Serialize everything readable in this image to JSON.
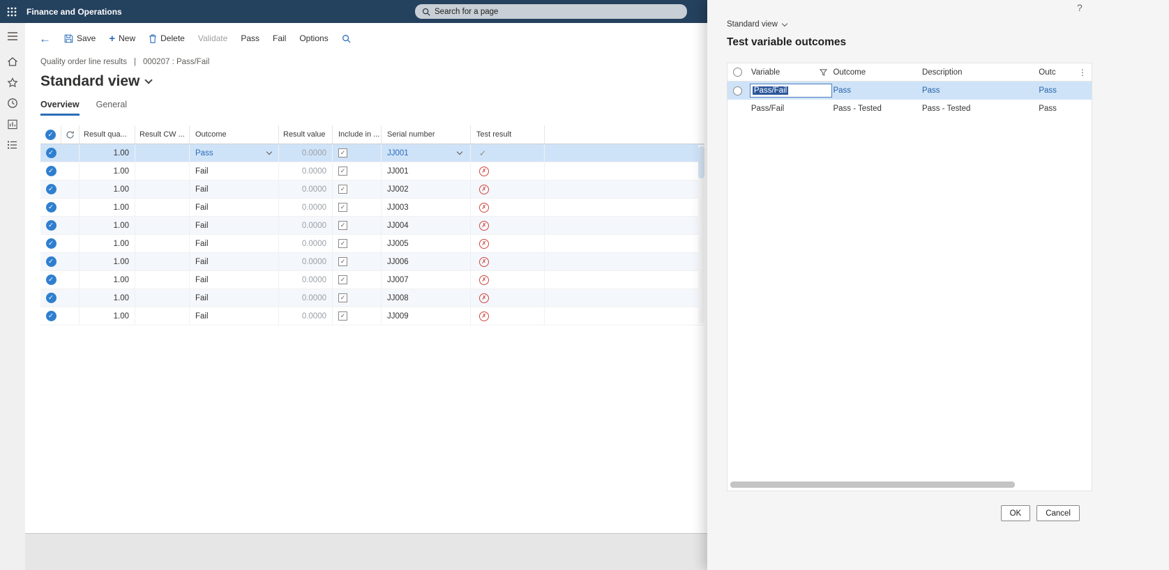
{
  "topbar": {
    "app_title": "Finance and Operations",
    "search_placeholder": "Search for a page"
  },
  "icons": {
    "check": "✓",
    "cross": "✗",
    "kebab": "⋮",
    "back": "←",
    "plus": "+",
    "help": "?"
  },
  "colors": {
    "topbar": "#24415e",
    "accent": "#2b6cb8",
    "selected_row": "#cfe3f8",
    "fail_red": "#d0453f"
  },
  "sidebar": {
    "items": [
      {
        "name": "menu"
      },
      {
        "name": "home"
      },
      {
        "name": "favorites"
      },
      {
        "name": "recent"
      },
      {
        "name": "workspaces"
      },
      {
        "name": "modules"
      }
    ]
  },
  "toolbar": {
    "save": "Save",
    "new": "New",
    "delete": "Delete",
    "validate": "Validate",
    "pass": "Pass",
    "fail": "Fail",
    "options": "Options"
  },
  "breadcrumb": {
    "page": "Quality order line results",
    "separator": "|",
    "record": "000207 : Pass/Fail"
  },
  "page": {
    "title": "Standard view"
  },
  "tabs": [
    {
      "label": "Overview",
      "active": true
    },
    {
      "label": "General",
      "active": false
    }
  ],
  "grid": {
    "columns": [
      "Result qua...",
      "Result CW ...",
      "Outcome",
      "Result value",
      "Include in ...",
      "Serial number",
      "Test result"
    ],
    "rows": [
      {
        "selected": true,
        "result_qty": "1.00",
        "result_cw": "",
        "outcome": "Pass",
        "result_value": "0.0000",
        "include": true,
        "serial": "JJ001",
        "test_result": "pass"
      },
      {
        "selected": false,
        "result_qty": "1.00",
        "result_cw": "",
        "outcome": "Fail",
        "result_value": "0.0000",
        "include": true,
        "serial": "JJ001",
        "test_result": "fail"
      },
      {
        "selected": false,
        "result_qty": "1.00",
        "result_cw": "",
        "outcome": "Fail",
        "result_value": "0.0000",
        "include": true,
        "serial": "JJ002",
        "test_result": "fail"
      },
      {
        "selected": false,
        "result_qty": "1.00",
        "result_cw": "",
        "outcome": "Fail",
        "result_value": "0.0000",
        "include": true,
        "serial": "JJ003",
        "test_result": "fail"
      },
      {
        "selected": false,
        "result_qty": "1.00",
        "result_cw": "",
        "outcome": "Fail",
        "result_value": "0.0000",
        "include": true,
        "serial": "JJ004",
        "test_result": "fail"
      },
      {
        "selected": false,
        "result_qty": "1.00",
        "result_cw": "",
        "outcome": "Fail",
        "result_value": "0.0000",
        "include": true,
        "serial": "JJ005",
        "test_result": "fail"
      },
      {
        "selected": false,
        "result_qty": "1.00",
        "result_cw": "",
        "outcome": "Fail",
        "result_value": "0.0000",
        "include": true,
        "serial": "JJ006",
        "test_result": "fail"
      },
      {
        "selected": false,
        "result_qty": "1.00",
        "result_cw": "",
        "outcome": "Fail",
        "result_value": "0.0000",
        "include": true,
        "serial": "JJ007",
        "test_result": "fail"
      },
      {
        "selected": false,
        "result_qty": "1.00",
        "result_cw": "",
        "outcome": "Fail",
        "result_value": "0.0000",
        "include": true,
        "serial": "JJ008",
        "test_result": "fail"
      },
      {
        "selected": false,
        "result_qty": "1.00",
        "result_cw": "",
        "outcome": "Fail",
        "result_value": "0.0000",
        "include": true,
        "serial": "JJ009",
        "test_result": "fail"
      }
    ]
  },
  "panel": {
    "view_label": "Standard view",
    "title": "Test variable outcomes",
    "columns": [
      "Variable",
      "Outcome",
      "Description",
      "Outc"
    ],
    "rows": [
      {
        "selected": true,
        "editing": true,
        "variable": "Pass/Fail",
        "outcome": "Pass",
        "description": "Pass",
        "outc": "Pass"
      },
      {
        "selected": false,
        "editing": false,
        "variable": "Pass/Fail",
        "outcome": "Pass - Tested",
        "description": "Pass - Tested",
        "outc": "Pass"
      }
    ],
    "ok": "OK",
    "cancel": "Cancel"
  }
}
